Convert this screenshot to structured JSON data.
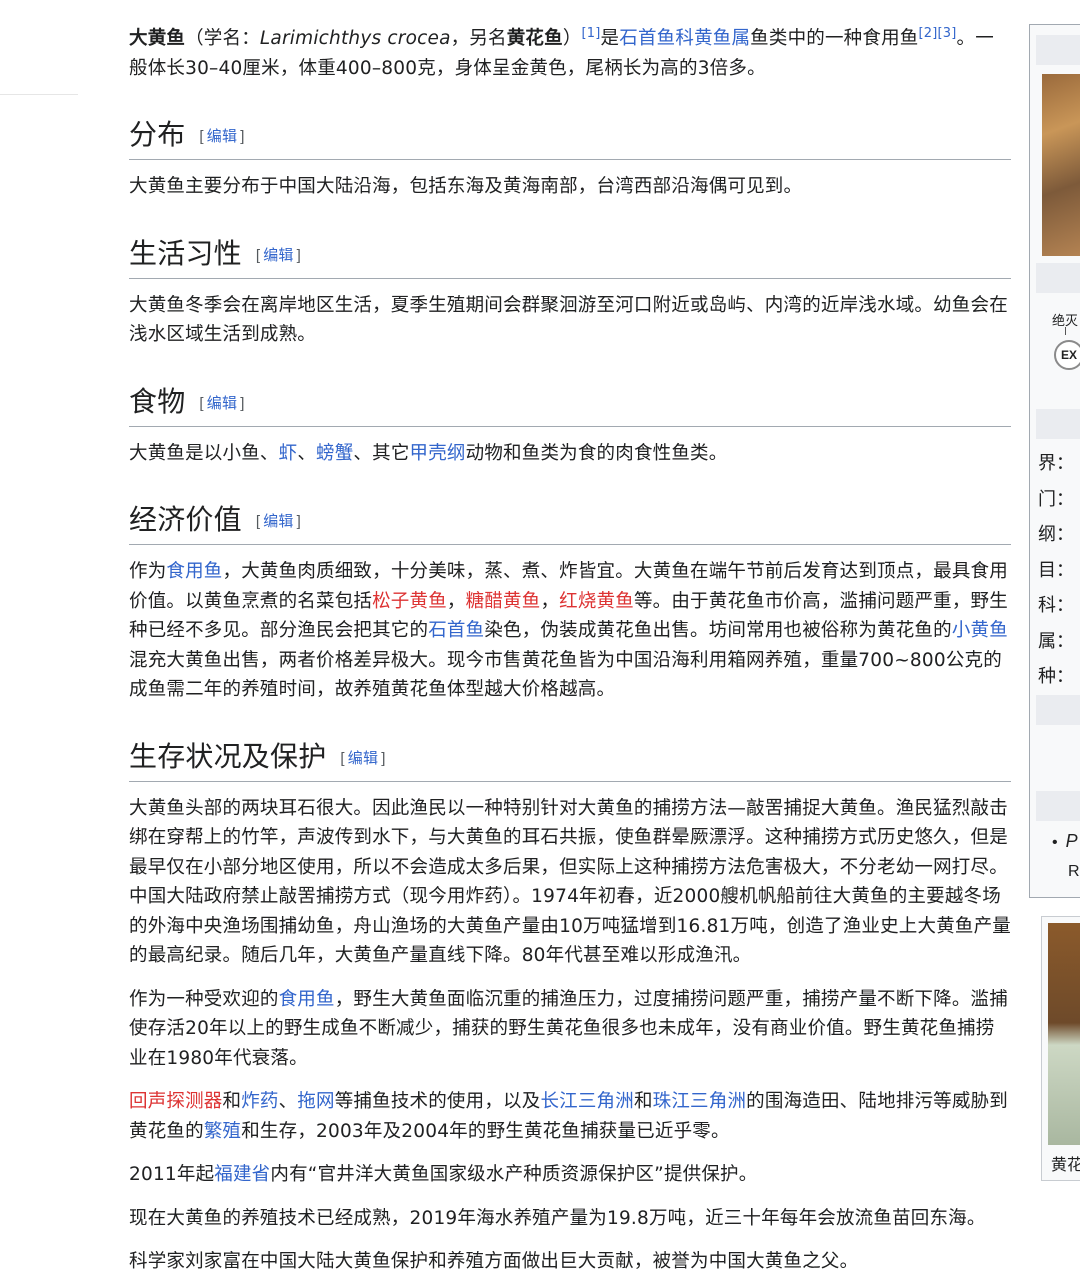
{
  "intro": {
    "name": "大黄鱼",
    "sci_prefix": "（学名：",
    "sci_name": "Larimichthys crocea",
    "alias_prefix": "，另名",
    "alias": "黄花鱼",
    "close_paren": "）",
    "ref1": "[1]",
    "is_text": "是",
    "link_family": "石首鱼科",
    "link_genus": "黄鱼属",
    "mid_text": "鱼类中的一种食用鱼",
    "ref2": "[2]",
    "ref3": "[3]",
    "tail": "。一般体长30–40厘米，体重400–800克，身体呈金黄色，尾柄长为高的3倍多。"
  },
  "edit_label": "编辑",
  "edit_open": "[",
  "edit_close": "]",
  "sections": {
    "distribution": {
      "title": "分布",
      "text": "大黄鱼主要分布于中国大陆沿海，包括东海及黄海南部，台湾西部沿海偶可见到。"
    },
    "habits": {
      "title": "生活习性",
      "text": "大黄鱼冬季会在离岸地区生活，夏季生殖期间会群聚洄游至河口附近或岛屿、内湾的近岸浅水域。幼鱼会在浅水区域生活到成熟。"
    },
    "food": {
      "title": "食物",
      "t1": "大黄鱼是以小鱼、",
      "l1": "虾",
      "t2": "、",
      "l2": "螃蟹",
      "t3": "、其它",
      "l3": "甲壳纲",
      "t4": "动物和鱼类为食的肉食性鱼类。"
    },
    "economy": {
      "title": "经济价值",
      "t1": "作为",
      "l1": "食用鱼",
      "t2": "，大黄鱼肉质细致，十分美味，蒸、煮、炸皆宜。大黄鱼在端午节前后发育达到顶点，最具食用价值。以黄鱼烹煮的名菜包括",
      "r1": "松子黄鱼",
      "t3": "，",
      "r2": "糖醋黄鱼",
      "t4": "，",
      "r3": "红烧黄鱼",
      "t5": "等。由于黄花鱼市价高，滥捕问题严重，野生种已经不多见。部分渔民会把其它的",
      "l2": "石首鱼",
      "t6": "染色，伪装成黄花鱼出售。坊间常用也被俗称为黄花鱼的",
      "l3": "小黄鱼",
      "t7": "混充大黄鱼出售，两者价格差异极大。现今市售黄花鱼皆为中国沿海利用箱网养殖，重量700~800公克的成鱼需二年的养殖时间，故养殖黄花鱼体型越大价格越高。"
    },
    "conservation": {
      "title": "生存状况及保护",
      "p1": "大黄鱼头部的两块耳石很大。因此渔民以一种特别针对大黄鱼的捕捞方法—敲罟捕捉大黄鱼。渔民猛烈敲击绑在穿帮上的竹竿，声波传到水下，与大黄鱼的耳石共振，使鱼群晕厥漂浮。这种捕捞方式历史悠久，但是最早仅在小部分地区使用，所以不会造成太多后果，但实际上这种捕捞方法危害极大，不分老幼一网打尽。中国大陆政府禁止敲罟捕捞方式（现今用炸药）。1974年初春，近2000艘机帆船前往大黄鱼的主要越冬场的外海中央渔场围捕幼鱼，舟山渔场的大黄鱼产量由10万吨猛增到16.81万吨，创造了渔业史上大黄鱼产量的最高纪录。随后几年，大黄鱼产量直线下降。80年代甚至难以形成渔汛。",
      "p2_t1": "作为一种受欢迎的",
      "p2_l1": "食用鱼",
      "p2_t2": "，野生大黄鱼面临沉重的捕渔压力，过度捕捞问题严重，捕捞产量不断下降。滥捕使存活20年以上的野生成鱼不断减少，捕获的野生黄花鱼很多也未成年，没有商业价值。野生黄花鱼捕捞业在1980年代衰落。",
      "p3_r1": "回声探测器",
      "p3_t1": "和",
      "p3_l1": "炸药",
      "p3_t2": "、",
      "p3_l2": "拖网",
      "p3_t3": "等捕鱼技术的使用，以及",
      "p3_l3": "长江三角洲",
      "p3_t4": "和",
      "p3_l4": "珠江三角洲",
      "p3_t5": "的围海造田、陆地排污等威胁到黄花鱼的",
      "p3_l5": "繁殖",
      "p3_t6": "和生存，2003年及2004年的野生黄花鱼捕获量已近乎零。",
      "p4_t1": "2011年起",
      "p4_l1": "福建省",
      "p4_t2": "内有“官井洋大黄鱼国家级水产种质资源保护区”提供保护。",
      "p5": "现在大黄鱼的养殖技术已经成熟，2019年海水养殖产量为19.8万吨，近三十年每年会放流鱼苗回东海。",
      "p6": "科学家刘家富在中国大陆大黄鱼保护和养殖方面做出巨大贡献，被誉为中国大黄鱼之父。"
    }
  },
  "infobox": {
    "status_label": "绝灭",
    "status_code": "EX",
    "ranks": [
      "界：",
      "门：",
      "纲：",
      "目：",
      "科：",
      "属：",
      "种："
    ],
    "bullet_text": "P",
    "r_text": "R",
    "thumb_caption": "黄花"
  },
  "colors": {
    "link": "#3366cc",
    "redlink": "#dd3333",
    "text": "#202122"
  }
}
